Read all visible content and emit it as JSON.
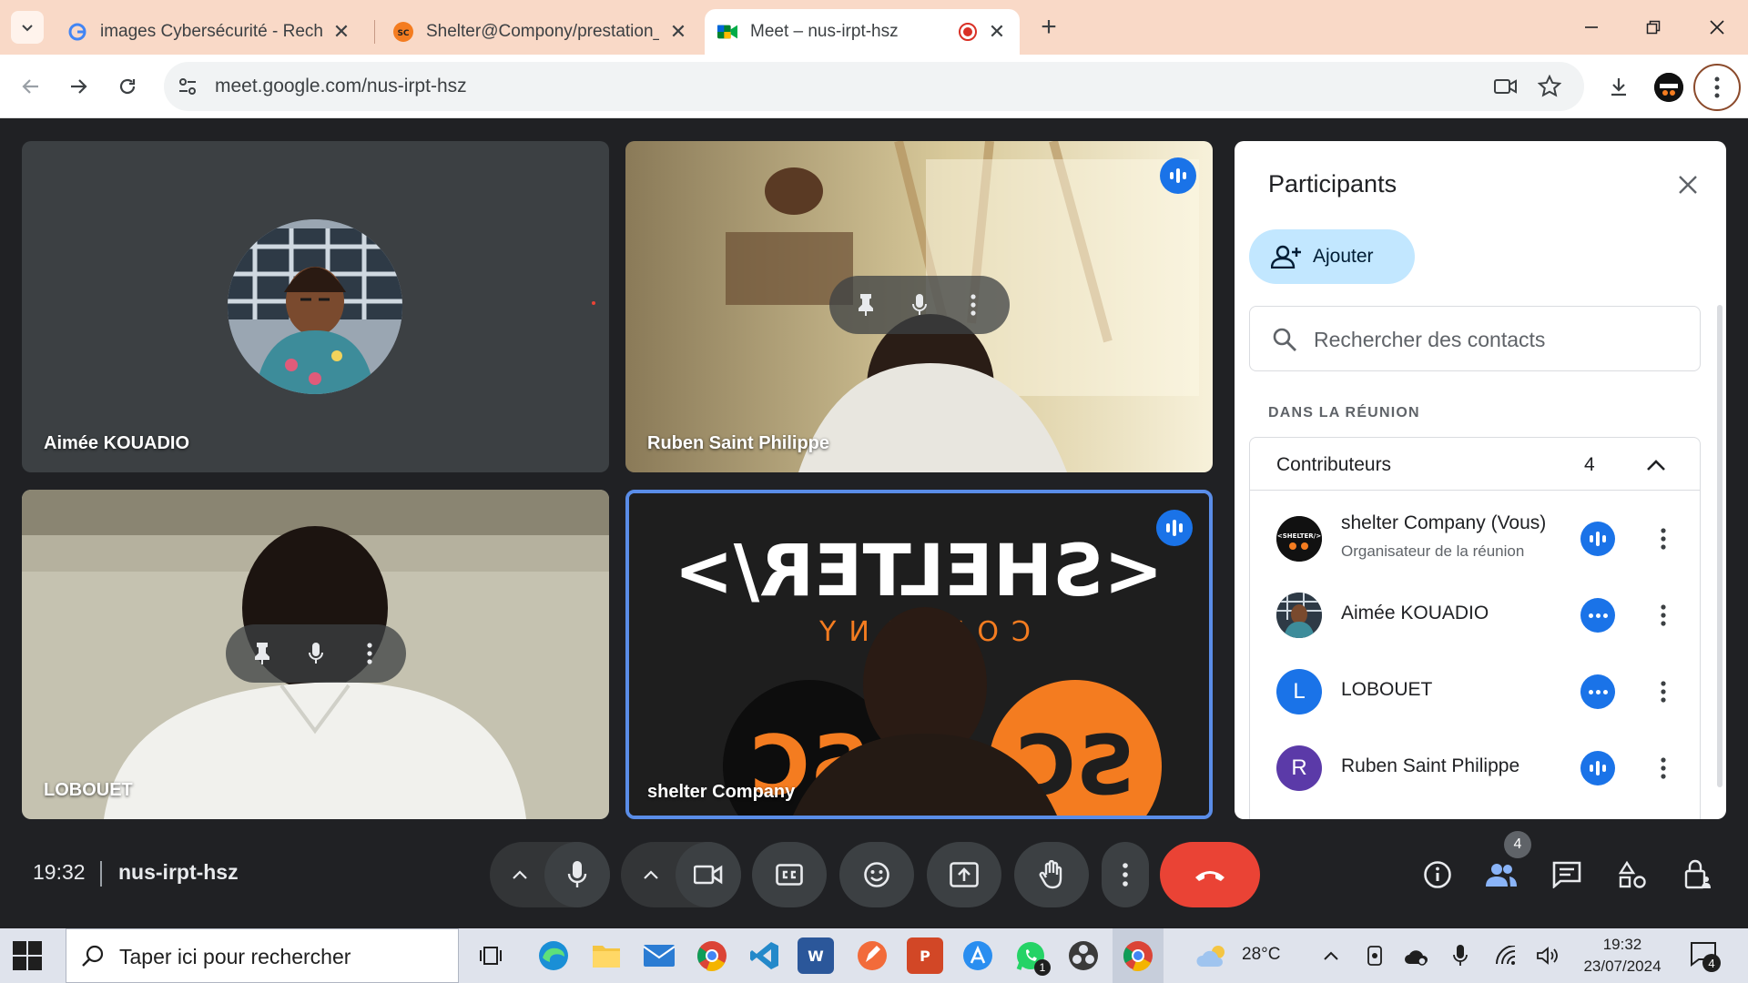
{
  "browser": {
    "tabs": [
      {
        "title": "images Cybersécurité - Recherche"
      },
      {
        "title": "Shelter@Compony/prestation_client"
      },
      {
        "title": "Meet – nus-irpt-hsz"
      }
    ],
    "tab_close": "✕",
    "new_tab": "+",
    "url": "meet.google.com/nus-irpt-hsz"
  },
  "tiles": {
    "aimee": {
      "name": "Aimée KOUADIO"
    },
    "ruben": {
      "name": "Ruben Saint Philippe"
    },
    "lobouet": {
      "name": "LOBOUET"
    },
    "shelter": {
      "name": "shelter Company"
    }
  },
  "panel": {
    "title": "Participants",
    "add_label": "Ajouter",
    "search_placeholder": "Rechercher des contacts",
    "section_label": "DANS LA RÉUNION",
    "group": {
      "label": "Contributeurs",
      "count": "4"
    },
    "participants": [
      {
        "name": "shelter Company (Vous)",
        "subtitle": "Organisateur de la réunion",
        "status": "speaking"
      },
      {
        "name": "Aimée KOUADIO",
        "subtitle": "",
        "status": "muted"
      },
      {
        "name": "LOBOUET",
        "initial": "L",
        "subtitle": "",
        "status": "muted"
      },
      {
        "name": "Ruben Saint Philippe",
        "initial": "R",
        "subtitle": "",
        "status": "speaking"
      }
    ]
  },
  "meet_bar": {
    "time": "19:32",
    "code": "nus-irpt-hsz",
    "participant_count": "4"
  },
  "taskbar": {
    "search_placeholder": "Taper ici pour rechercher",
    "weather": "28°C",
    "time": "19:32",
    "date": "23/07/2024",
    "notification_count": "4",
    "whatsapp_badge": "1"
  },
  "colors": {
    "tab_strip": "#f9d9c7",
    "meet_background": "#202124",
    "accent_blue": "#1a73e8",
    "hangup_red": "#ea4335",
    "add_button": "#c2e7ff",
    "shelter_orange": "#f47c20"
  }
}
